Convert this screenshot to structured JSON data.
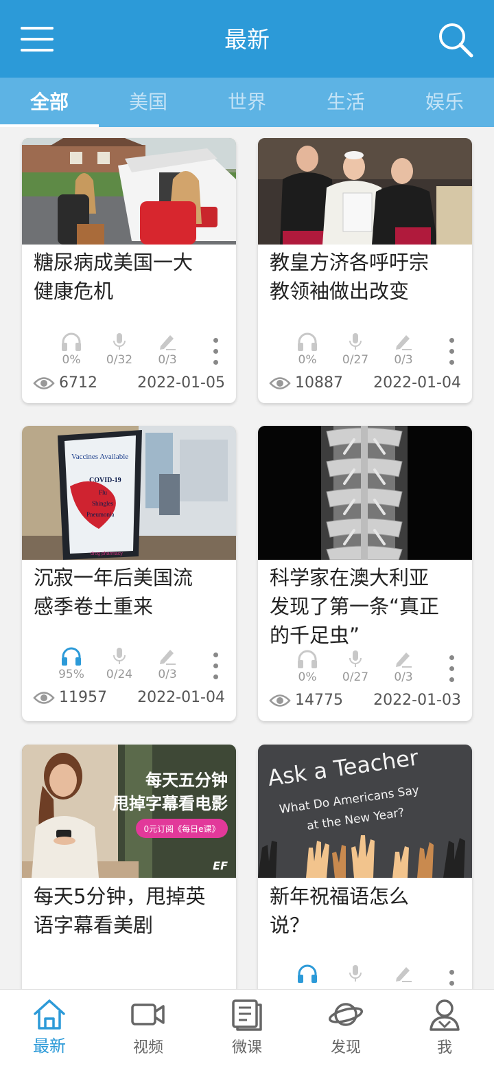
{
  "header": {
    "title": "最新"
  },
  "tabs": [
    {
      "label": "全部",
      "active": true
    },
    {
      "label": "美国"
    },
    {
      "label": "世界"
    },
    {
      "label": "生活"
    },
    {
      "label": "娱乐"
    }
  ],
  "articles": [
    {
      "title_line1": "糖尿病成美国一大",
      "title_line2": "健康危机",
      "title_line3": "",
      "listen": "0%",
      "speak": "0/32",
      "write": "0/3",
      "views": "6712",
      "date": "2022-01-05"
    },
    {
      "title_line1": "教皇方济各呼吁宗",
      "title_line2": "教领袖做出改变",
      "title_line3": "",
      "listen": "0%",
      "speak": "0/27",
      "write": "0/3",
      "views": "10887",
      "date": "2022-01-04"
    },
    {
      "title_line1": "沉寂一年后美国流",
      "title_line2": "感季卷土重来",
      "title_line3": "",
      "listen": "95%",
      "speak": "0/24",
      "write": "0/3",
      "views": "11957",
      "date": "2022-01-04"
    },
    {
      "title_line1": "科学家在澳大利亚",
      "title_line2": "发现了第一条“真正",
      "title_line3": "的千足虫”",
      "listen": "0%",
      "speak": "0/27",
      "write": "0/3",
      "views": "14775",
      "date": "2022-01-03"
    },
    {
      "title_line1": "每天5分钟，甩掉英",
      "title_line2": "语字幕看美剧",
      "title_line3": ""
    },
    {
      "title_line1": "新年祝福语怎么",
      "title_line2": "说？",
      "title_line3": ""
    }
  ],
  "images": {
    "vaccine_sign": [
      "Vaccines Available",
      "COVID-19",
      "Flu",
      "Shingles",
      "Pneumonia",
      "drug pharmacy"
    ],
    "ad_line1": "每天五分钟",
    "ad_line2": "甩掉字幕看电影",
    "ad_button": "0元订阅《每日e课》",
    "ad_logo": "EF",
    "teacher_line1": "Ask a Teacher",
    "teacher_line2": "What Do Americans Say",
    "teacher_line3": "at the New Year?"
  },
  "nav": [
    {
      "label": "最新",
      "icon": "home-icon",
      "active": true
    },
    {
      "label": "视频",
      "icon": "video-camera-icon"
    },
    {
      "label": "微课",
      "icon": "book-icon"
    },
    {
      "label": "发现",
      "icon": "planet-icon"
    },
    {
      "label": "我",
      "icon": "user-icon"
    }
  ],
  "colors": {
    "header": "#2c9ad8",
    "tab_bar": "#5db3e4",
    "accent": "#2c9ad8",
    "inactive_icon": "#c8c8c8"
  }
}
